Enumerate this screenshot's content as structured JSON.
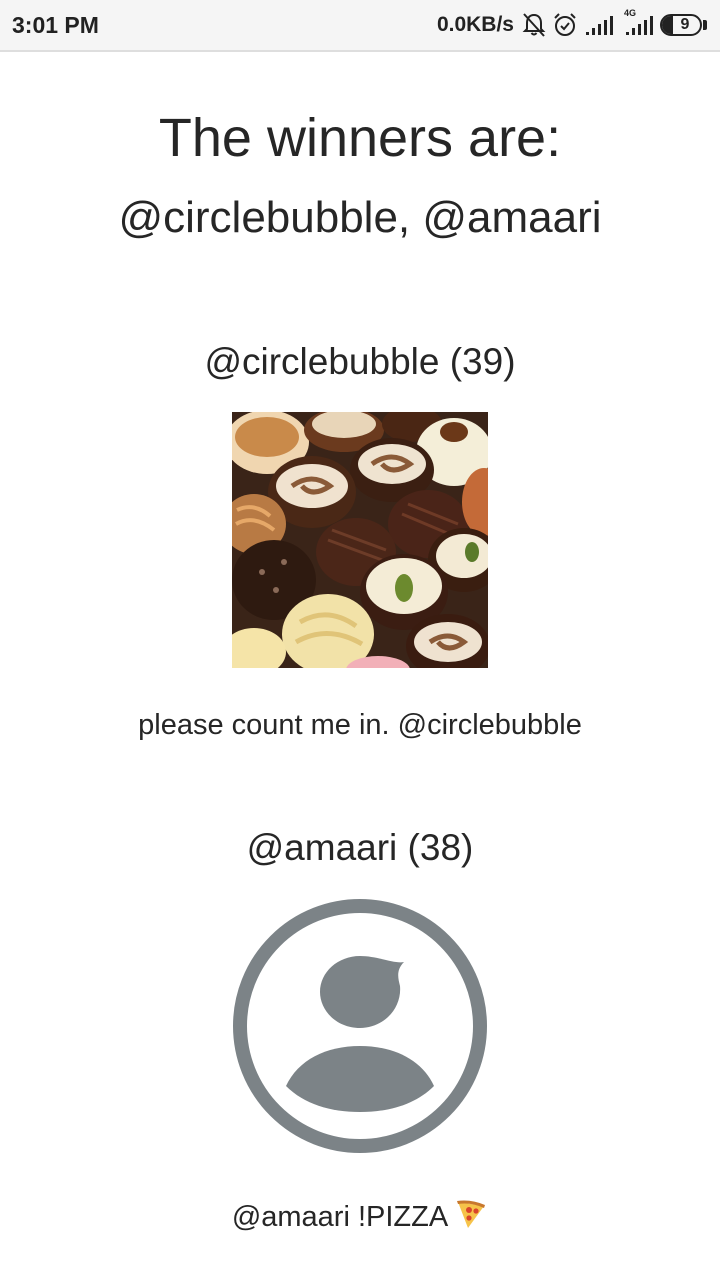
{
  "status_bar": {
    "time": "3:01 PM",
    "network_speed": "0.0KB/s",
    "network_type": "4G",
    "battery_level": "9",
    "icons": [
      "bell-off-icon",
      "alarm-icon",
      "signal-icon",
      "signal-4g-icon",
      "battery-icon"
    ]
  },
  "winners": {
    "title": "The winners are:",
    "list": "@circlebubble, @amaari"
  },
  "entries": [
    {
      "title": "@circlebubble (39)",
      "image": "chocolates-photo",
      "text": "please count me in. @circlebubble"
    },
    {
      "title": "@amaari (38)",
      "image": "default-avatar-icon",
      "text": "@amaari !PIZZA",
      "emoji": "pizza-icon"
    }
  ],
  "colors": {
    "text": "#262626",
    "status_bar_bg": "#f5f5f5",
    "avatar_gray": "#7c8387"
  }
}
